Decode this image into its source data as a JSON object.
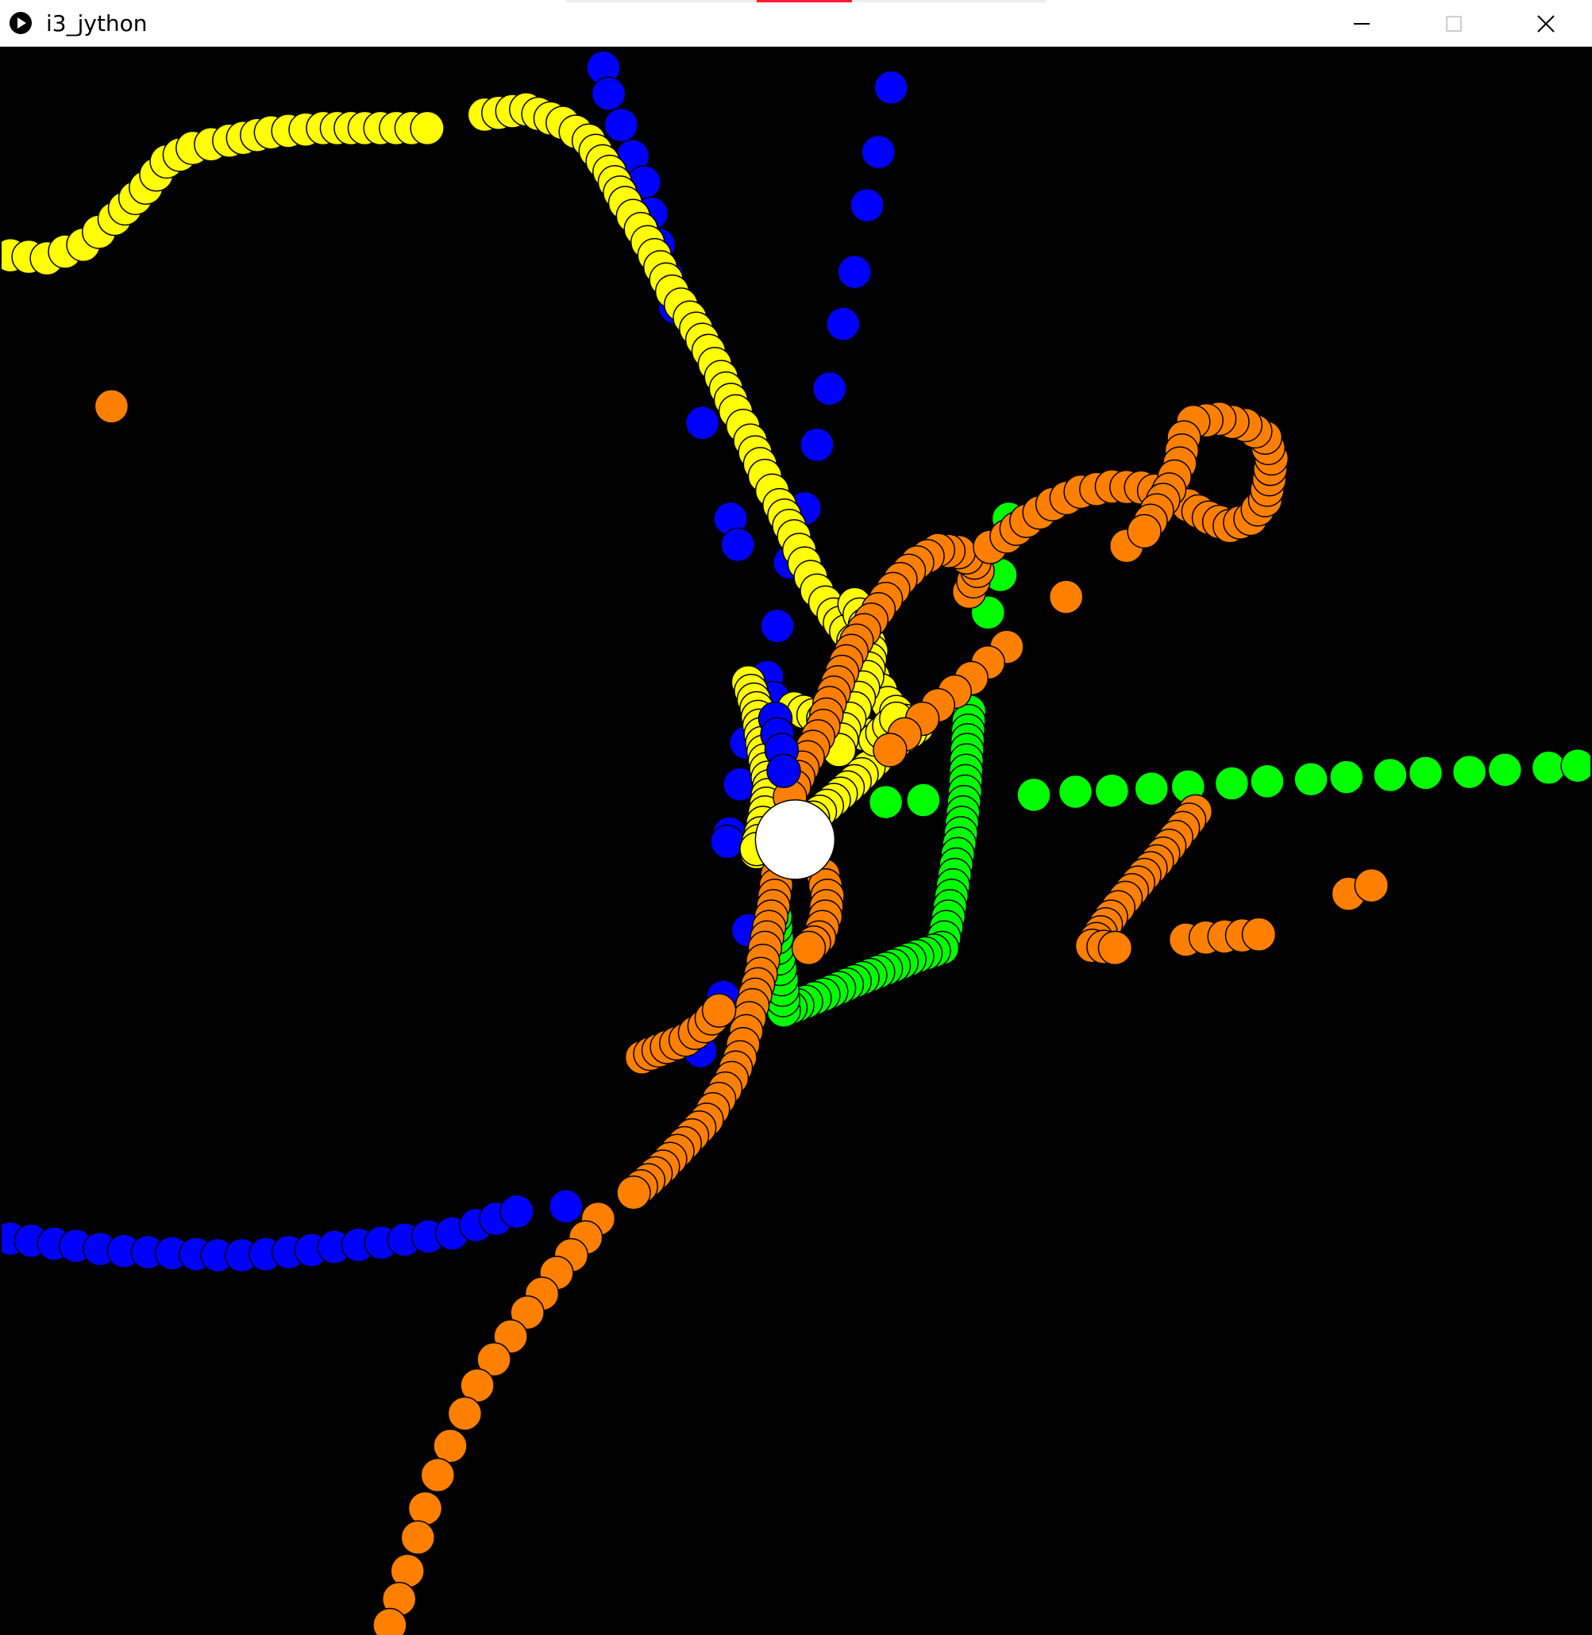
{
  "window": {
    "title": "i3_jython",
    "controls": {
      "minimize": "minimize-icon",
      "maximize": "maximize-icon",
      "close": "close-icon"
    }
  },
  "canvas": {
    "background": "#000000",
    "stroke": "#000000",
    "colors": {
      "blue": "#0000ff",
      "yellow": "#ffff00",
      "green": "#00ff00",
      "orange": "#ff8000",
      "white": "#ffffff"
    }
  }
}
